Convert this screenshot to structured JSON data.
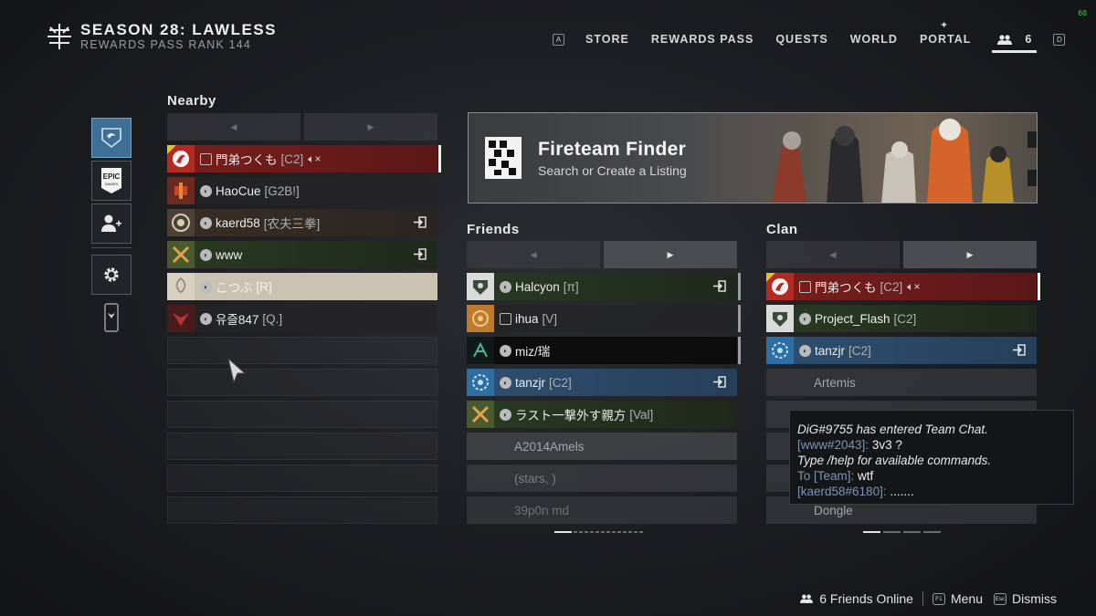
{
  "fps": "60",
  "season": {
    "title": "SEASON 28: LAWLESS",
    "subtitle": "REWARDS PASS RANK 144"
  },
  "nav": {
    "left_key": "A",
    "items": [
      "STORE",
      "REWARDS PASS",
      "QUESTS",
      "WORLD",
      "PORTAL"
    ],
    "friends_count": "6",
    "right_key": "D"
  },
  "rail": [
    "clan-banner-icon",
    "epic-games-icon",
    "add-friend-icon",
    "settings-icon",
    "companion-app-icon"
  ],
  "epic_label": "EPIC",
  "epic_sub": "GAMES",
  "nearby": {
    "title": "Nearby",
    "rows": [
      {
        "name": "門弟つくも",
        "tag": "[C2]",
        "style": "red",
        "platform": "pc"
      },
      {
        "name": "HaoCue",
        "tag": "[G2B!]",
        "style": "dark",
        "platform": "steam"
      },
      {
        "name": "kaerd58",
        "tag": "[农夫三拳]",
        "style": "brownish",
        "platform": "steam",
        "join": true
      },
      {
        "name": "www",
        "tag": "",
        "style": "green",
        "platform": "steam",
        "join": true
      },
      {
        "name": "こつぶ",
        "tag": "[R]",
        "style": "beige",
        "platform": "steam"
      },
      {
        "name": "유즐847",
        "tag": "[Q.]",
        "style": "dark",
        "platform": "steam"
      }
    ]
  },
  "banner": {
    "title": "Fireteam Finder",
    "subtitle": "Search or Create a Listing"
  },
  "friends": {
    "title": "Friends",
    "rows": [
      {
        "name": "Halcyon",
        "tag": "[π]",
        "style": "green",
        "platform": "steam",
        "join": true
      },
      {
        "name": "ihua",
        "tag": "[V]",
        "style": "dark",
        "platform": "pc"
      },
      {
        "name": "miz/瑞",
        "tag": "",
        "style": "black",
        "platform": "steam"
      },
      {
        "name": "tanzjr",
        "tag": "[C2]",
        "style": "blue",
        "platform": "steam",
        "join": true
      },
      {
        "name": "ラスト一撃外す親方",
        "tag": "[Val]",
        "style": "green",
        "platform": "steam"
      },
      {
        "name": "A2014Amels",
        "style": "offline"
      },
      {
        "name": "(stars, )",
        "style": "offline"
      },
      {
        "name": "39p0n md",
        "style": "offline"
      }
    ]
  },
  "clan": {
    "title": "Clan",
    "rows": [
      {
        "name": "門弟つくも",
        "tag": "[C2]",
        "style": "red",
        "platform": "pc"
      },
      {
        "name": "Project_Flash",
        "tag": "[C2]",
        "style": "green",
        "platform": "steam"
      },
      {
        "name": "tanzjr",
        "tag": "[C2]",
        "style": "blue",
        "platform": "steam",
        "join": true
      },
      {
        "name": "Artemis",
        "style": "offline"
      },
      {
        "name": "",
        "style": "offline"
      },
      {
        "name": "",
        "style": "offline"
      },
      {
        "name": "",
        "style": "offline"
      },
      {
        "name": "Dongle",
        "style": "offline"
      }
    ]
  },
  "chat": {
    "line1": "DiG#9755 has entered Team Chat.",
    "line2_channel": "[www#2043]:",
    "line2_msg": "3v3 ?",
    "line3": "Type /help for available commands.",
    "line4_channel": "To [Team]:",
    "line4_msg": "wtf",
    "line5_channel": "[kaerd58#6180]:",
    "line5_msg": "......."
  },
  "footer": {
    "online": "6 Friends Online",
    "menu_key": "F1",
    "menu": "Menu",
    "dismiss_key": "Esc",
    "dismiss": "Dismiss"
  }
}
